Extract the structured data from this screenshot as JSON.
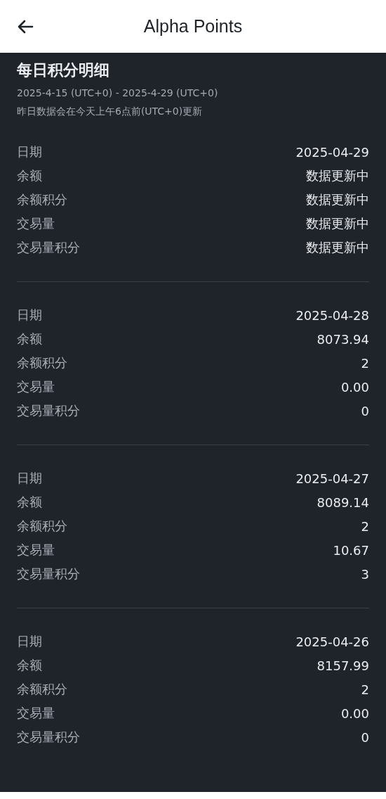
{
  "header": {
    "title": "Alpha Points"
  },
  "summary": {
    "title": "每日积分明细",
    "range": "2025-4-15 (UTC+0) - 2025-4-29 (UTC+0)",
    "note": "昨日数据会在今天上午6点前(UTC+0)更新"
  },
  "records": [
    {
      "rows": [
        {
          "label": "日期",
          "value": "2025-04-29"
        },
        {
          "label": "余额",
          "value": "数据更新中"
        },
        {
          "label": "余额积分",
          "value": "数据更新中"
        },
        {
          "label": "交易量",
          "value": "数据更新中"
        },
        {
          "label": "交易量积分",
          "value": "数据更新中"
        }
      ]
    },
    {
      "rows": [
        {
          "label": "日期",
          "value": "2025-04-28"
        },
        {
          "label": "余额",
          "value": "8073.94"
        },
        {
          "label": "余额积分",
          "value": "2"
        },
        {
          "label": "交易量",
          "value": "0.00"
        },
        {
          "label": "交易量积分",
          "value": "0"
        }
      ]
    },
    {
      "rows": [
        {
          "label": "日期",
          "value": "2025-04-27"
        },
        {
          "label": "余额",
          "value": "8089.14"
        },
        {
          "label": "余额积分",
          "value": "2"
        },
        {
          "label": "交易量",
          "value": "10.67"
        },
        {
          "label": "交易量积分",
          "value": "3"
        }
      ]
    },
    {
      "rows": [
        {
          "label": "日期",
          "value": "2025-04-26"
        },
        {
          "label": "余额",
          "value": "8157.99"
        },
        {
          "label": "余额积分",
          "value": "2"
        },
        {
          "label": "交易量",
          "value": "0.00"
        },
        {
          "label": "交易量积分",
          "value": "0"
        }
      ]
    }
  ]
}
